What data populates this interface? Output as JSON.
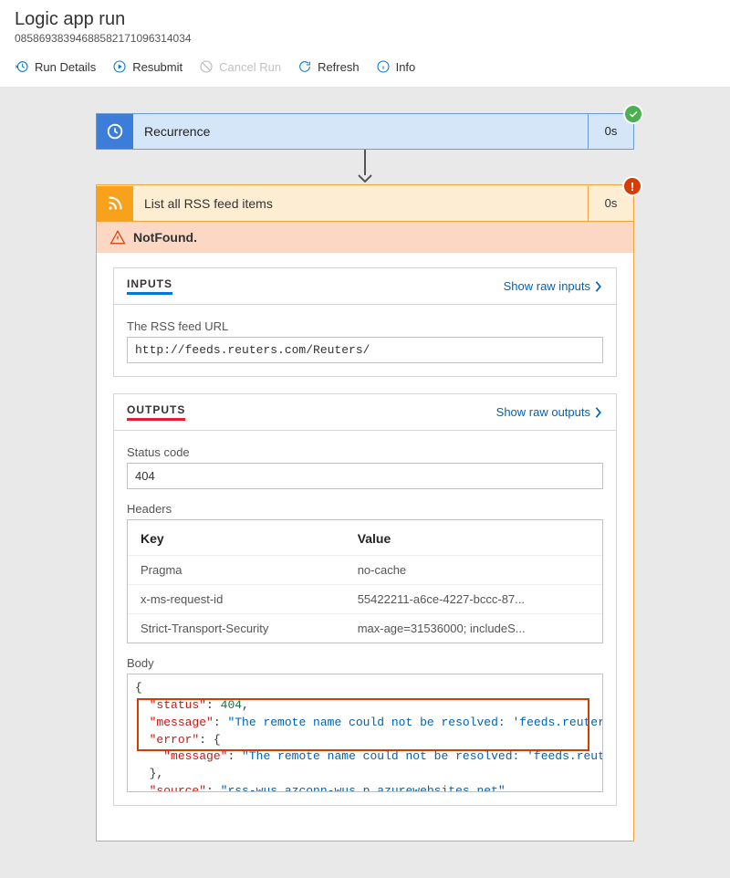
{
  "page": {
    "title": "Logic app run",
    "run_id": "08586938394688582171096314034"
  },
  "toolbar": {
    "run_details": "Run Details",
    "resubmit": "Resubmit",
    "cancel_run": "Cancel Run",
    "refresh": "Refresh",
    "info": "Info"
  },
  "steps": {
    "recurrence": {
      "title": "Recurrence",
      "duration": "0s",
      "status": "success"
    },
    "rss": {
      "title": "List all RSS feed items",
      "duration": "0s",
      "status": "error"
    }
  },
  "error_strip": "NotFound.",
  "inputs": {
    "heading": "INPUTS",
    "raw_link": "Show raw inputs",
    "feed_url_label": "The RSS feed URL",
    "feed_url": "http://feeds.reuters.com/Reuters/"
  },
  "outputs": {
    "heading": "OUTPUTS",
    "raw_link": "Show raw outputs",
    "status_code_label": "Status code",
    "status_code": "404",
    "headers_label": "Headers",
    "headers_columns": {
      "key": "Key",
      "value": "Value"
    },
    "headers": [
      {
        "key": "Pragma",
        "value": "no-cache"
      },
      {
        "key": "x-ms-request-id",
        "value": "55422211-a6ce-4227-bccc-87..."
      },
      {
        "key": "Strict-Transport-Security",
        "value": "max-age=31536000; includeS..."
      }
    ],
    "body_label": "Body",
    "body_json": {
      "status": 404,
      "message": "The remote name could not be resolved: 'feeds.reuters",
      "error_message": "The remote name could not be resolved: 'feeds.reute",
      "source": "rss-wus.azconn-wus.p.azurewebsites.net"
    }
  }
}
